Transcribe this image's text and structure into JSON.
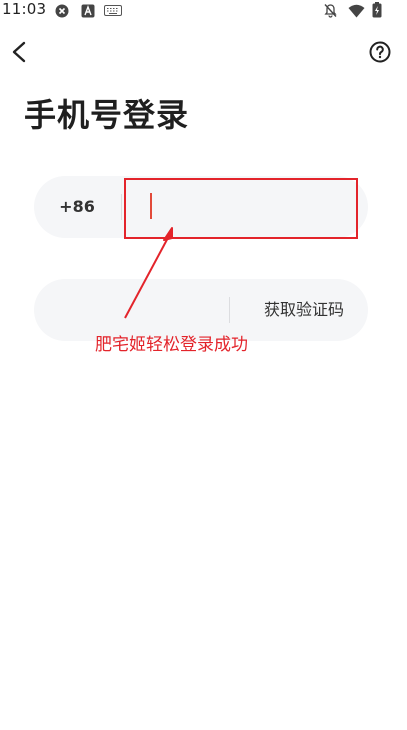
{
  "status_bar": {
    "time": "11:03",
    "icons": [
      "shield-x-icon",
      "a-icon",
      "keyboard-icon",
      "bell-off-icon",
      "wifi-icon",
      "battery-icon"
    ]
  },
  "header": {
    "back_icon": "chevron-left-icon",
    "help_icon": "help-circle-icon"
  },
  "page": {
    "title": "手机号登录"
  },
  "form": {
    "country_code": "+86",
    "phone_value": "",
    "code_value": "",
    "get_code_label": "获取验证码"
  },
  "annotation": {
    "text": "肥宅姬轻松登录成功",
    "color": "#e3242b"
  }
}
